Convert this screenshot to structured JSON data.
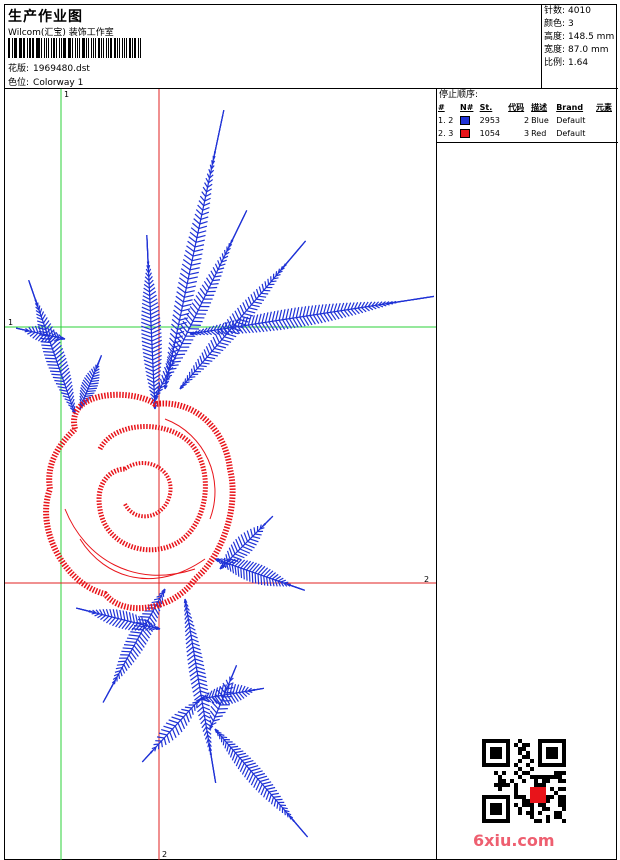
{
  "header": {
    "title": "生产作业图",
    "company": "Wilcom(汇宝) 装饰工作室",
    "design_label": "花版:",
    "design_value": "1969480.dst",
    "colorway_label": "色位:",
    "colorway_value": "Colorway 1"
  },
  "stats": [
    {
      "label": "针数:",
      "value": "4010"
    },
    {
      "label": "颜色:",
      "value": "3"
    },
    {
      "label": "高度:",
      "value": "148.5 mm"
    },
    {
      "label": "宽度:",
      "value": "87.0 mm"
    },
    {
      "label": "比例:",
      "value": "1.64"
    }
  ],
  "stop_sequence": {
    "title": "停止顺序:",
    "columns": [
      "#",
      "N#",
      "St.",
      "代码",
      "描述",
      "Brand",
      "元素"
    ],
    "rows": [
      {
        "idx": "1.",
        "n": "2",
        "swatch": "#1f32d6",
        "st": "2953",
        "code": "2",
        "desc": "Blue",
        "brand": "Default",
        "elem": ""
      },
      {
        "idx": "2.",
        "n": "3",
        "swatch": "#e8141a",
        "st": "1054",
        "code": "3",
        "desc": "Red",
        "brand": "Default",
        "elem": ""
      }
    ]
  },
  "axis_labels": {
    "top": "1",
    "left": "1",
    "right": "2",
    "bottom": "2"
  },
  "colors": {
    "thread_blue": "#1f32d6",
    "thread_red": "#e8141a",
    "guide_green": "#2bd13a",
    "guide_red": "#e02020"
  },
  "watermark": {
    "brand": "6xiu.com"
  }
}
